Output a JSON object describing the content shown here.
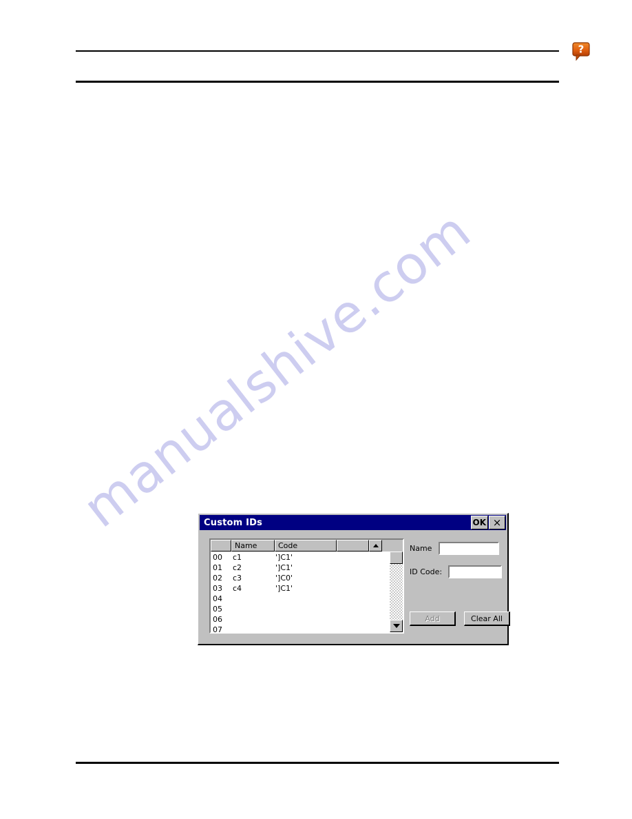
{
  "page": {
    "background_color": "#ffffff",
    "watermark_text": "manualshive.com",
    "watermark_color": "#c9c9ef"
  },
  "header": {
    "help_icon_name": "help-question-bubble-icon",
    "help_icon_glyph": "?",
    "help_icon_color": "#e06010"
  },
  "dialog": {
    "title": "Custom IDs",
    "title_bar_color": "#000082",
    "face_color": "#c0c0c0",
    "buttons": {
      "ok_label": "OK",
      "close_label": "×"
    },
    "list": {
      "columns": [
        "",
        "Name",
        "Code",
        "",
        ""
      ],
      "rows": [
        {
          "index": "00",
          "name": "c1",
          "code": "']C1'"
        },
        {
          "index": "01",
          "name": "c2",
          "code": "']C1'"
        },
        {
          "index": "02",
          "name": "c3",
          "code": "']C0'"
        },
        {
          "index": "03",
          "name": "c4",
          "code": "']C1'"
        },
        {
          "index": "04",
          "name": "",
          "code": ""
        },
        {
          "index": "05",
          "name": "",
          "code": ""
        },
        {
          "index": "06",
          "name": "",
          "code": ""
        },
        {
          "index": "07",
          "name": "",
          "code": ""
        }
      ],
      "scroll_up_glyph": "▲",
      "scroll_down_glyph": "▼"
    },
    "form": {
      "name_label": "Name",
      "name_value": "",
      "idcode_label": "ID Code:",
      "idcode_value": "",
      "add_label": "Add",
      "add_enabled": false,
      "clear_all_label": "Clear All",
      "clear_all_enabled": true
    }
  }
}
